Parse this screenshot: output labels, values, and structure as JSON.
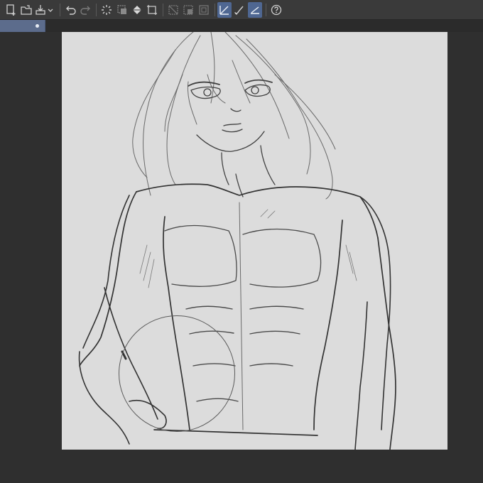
{
  "app": {
    "accent_color": "#4f6792",
    "toolbar_bg": "#3a3a3a",
    "canvas_bg": "#2f2f2f",
    "paper_color": "#dcdcdc"
  },
  "toolbar": {
    "buttons": [
      {
        "icon": "new-canvas-icon",
        "active": false
      },
      {
        "icon": "open-folder-icon",
        "active": false
      },
      {
        "icon": "save-icon",
        "active": false
      },
      {
        "icon": "chevron-down-icon",
        "active": false
      },
      {
        "icon": "undo-icon",
        "active": false
      },
      {
        "icon": "redo-icon",
        "active": false
      },
      {
        "icon": "loading-spinner-icon",
        "active": false
      },
      {
        "icon": "clear-layer-icon",
        "active": false
      },
      {
        "icon": "fill-bucket-icon",
        "active": false
      },
      {
        "icon": "transform-icon",
        "active": false
      },
      {
        "icon": "deselect-icon",
        "active": false
      },
      {
        "icon": "invert-selection-icon",
        "active": false
      },
      {
        "icon": "show-selection-icon",
        "active": false
      },
      {
        "icon": "snap-ruler-icon",
        "active": true
      },
      {
        "icon": "brush-snap-icon",
        "active": false
      },
      {
        "icon": "snap-special-ruler-icon",
        "active": true
      },
      {
        "icon": "help-icon",
        "active": false
      }
    ]
  },
  "document_tab": {
    "label": "",
    "modified": true
  }
}
